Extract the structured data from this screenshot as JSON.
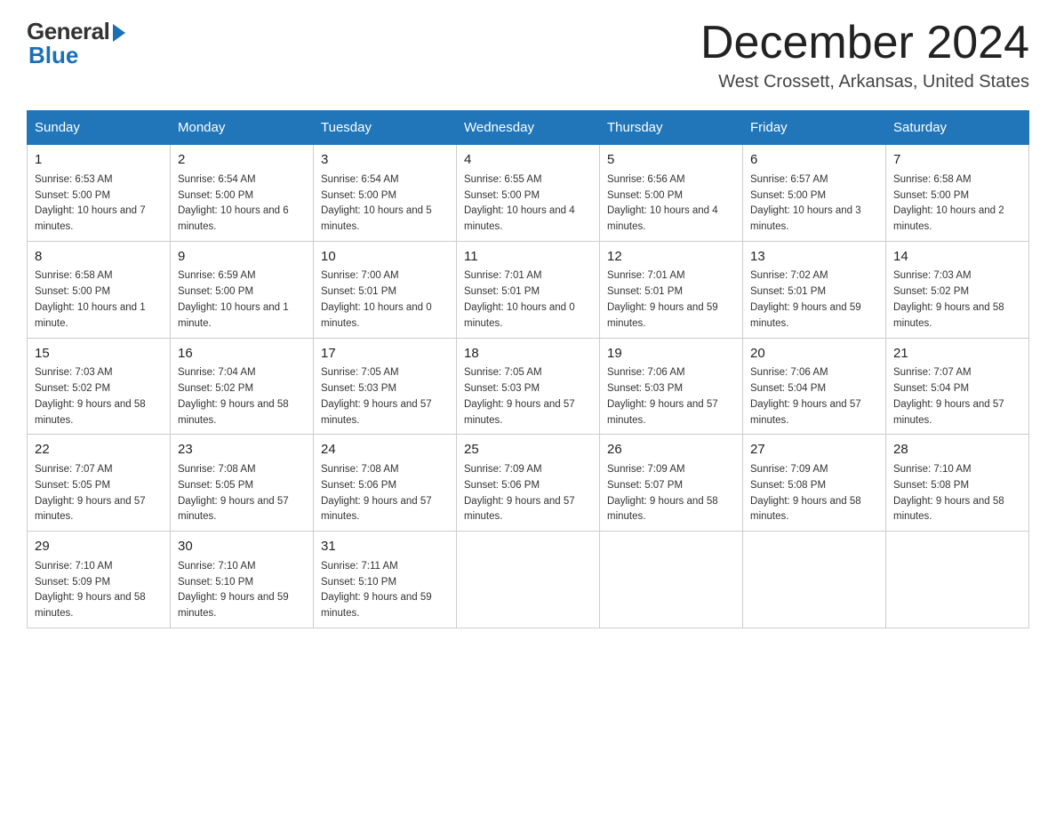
{
  "logo": {
    "general": "General",
    "blue": "Blue"
  },
  "title": {
    "month_year": "December 2024",
    "location": "West Crossett, Arkansas, United States"
  },
  "weekdays": [
    "Sunday",
    "Monday",
    "Tuesday",
    "Wednesday",
    "Thursday",
    "Friday",
    "Saturday"
  ],
  "weeks": [
    [
      {
        "day": "1",
        "sunrise": "6:53 AM",
        "sunset": "5:00 PM",
        "daylight": "10 hours and 7 minutes."
      },
      {
        "day": "2",
        "sunrise": "6:54 AM",
        "sunset": "5:00 PM",
        "daylight": "10 hours and 6 minutes."
      },
      {
        "day": "3",
        "sunrise": "6:54 AM",
        "sunset": "5:00 PM",
        "daylight": "10 hours and 5 minutes."
      },
      {
        "day": "4",
        "sunrise": "6:55 AM",
        "sunset": "5:00 PM",
        "daylight": "10 hours and 4 minutes."
      },
      {
        "day": "5",
        "sunrise": "6:56 AM",
        "sunset": "5:00 PM",
        "daylight": "10 hours and 4 minutes."
      },
      {
        "day": "6",
        "sunrise": "6:57 AM",
        "sunset": "5:00 PM",
        "daylight": "10 hours and 3 minutes."
      },
      {
        "day": "7",
        "sunrise": "6:58 AM",
        "sunset": "5:00 PM",
        "daylight": "10 hours and 2 minutes."
      }
    ],
    [
      {
        "day": "8",
        "sunrise": "6:58 AM",
        "sunset": "5:00 PM",
        "daylight": "10 hours and 1 minute."
      },
      {
        "day": "9",
        "sunrise": "6:59 AM",
        "sunset": "5:00 PM",
        "daylight": "10 hours and 1 minute."
      },
      {
        "day": "10",
        "sunrise": "7:00 AM",
        "sunset": "5:01 PM",
        "daylight": "10 hours and 0 minutes."
      },
      {
        "day": "11",
        "sunrise": "7:01 AM",
        "sunset": "5:01 PM",
        "daylight": "10 hours and 0 minutes."
      },
      {
        "day": "12",
        "sunrise": "7:01 AM",
        "sunset": "5:01 PM",
        "daylight": "9 hours and 59 minutes."
      },
      {
        "day": "13",
        "sunrise": "7:02 AM",
        "sunset": "5:01 PM",
        "daylight": "9 hours and 59 minutes."
      },
      {
        "day": "14",
        "sunrise": "7:03 AM",
        "sunset": "5:02 PM",
        "daylight": "9 hours and 58 minutes."
      }
    ],
    [
      {
        "day": "15",
        "sunrise": "7:03 AM",
        "sunset": "5:02 PM",
        "daylight": "9 hours and 58 minutes."
      },
      {
        "day": "16",
        "sunrise": "7:04 AM",
        "sunset": "5:02 PM",
        "daylight": "9 hours and 58 minutes."
      },
      {
        "day": "17",
        "sunrise": "7:05 AM",
        "sunset": "5:03 PM",
        "daylight": "9 hours and 57 minutes."
      },
      {
        "day": "18",
        "sunrise": "7:05 AM",
        "sunset": "5:03 PM",
        "daylight": "9 hours and 57 minutes."
      },
      {
        "day": "19",
        "sunrise": "7:06 AM",
        "sunset": "5:03 PM",
        "daylight": "9 hours and 57 minutes."
      },
      {
        "day": "20",
        "sunrise": "7:06 AM",
        "sunset": "5:04 PM",
        "daylight": "9 hours and 57 minutes."
      },
      {
        "day": "21",
        "sunrise": "7:07 AM",
        "sunset": "5:04 PM",
        "daylight": "9 hours and 57 minutes."
      }
    ],
    [
      {
        "day": "22",
        "sunrise": "7:07 AM",
        "sunset": "5:05 PM",
        "daylight": "9 hours and 57 minutes."
      },
      {
        "day": "23",
        "sunrise": "7:08 AM",
        "sunset": "5:05 PM",
        "daylight": "9 hours and 57 minutes."
      },
      {
        "day": "24",
        "sunrise": "7:08 AM",
        "sunset": "5:06 PM",
        "daylight": "9 hours and 57 minutes."
      },
      {
        "day": "25",
        "sunrise": "7:09 AM",
        "sunset": "5:06 PM",
        "daylight": "9 hours and 57 minutes."
      },
      {
        "day": "26",
        "sunrise": "7:09 AM",
        "sunset": "5:07 PM",
        "daylight": "9 hours and 58 minutes."
      },
      {
        "day": "27",
        "sunrise": "7:09 AM",
        "sunset": "5:08 PM",
        "daylight": "9 hours and 58 minutes."
      },
      {
        "day": "28",
        "sunrise": "7:10 AM",
        "sunset": "5:08 PM",
        "daylight": "9 hours and 58 minutes."
      }
    ],
    [
      {
        "day": "29",
        "sunrise": "7:10 AM",
        "sunset": "5:09 PM",
        "daylight": "9 hours and 58 minutes."
      },
      {
        "day": "30",
        "sunrise": "7:10 AM",
        "sunset": "5:10 PM",
        "daylight": "9 hours and 59 minutes."
      },
      {
        "day": "31",
        "sunrise": "7:11 AM",
        "sunset": "5:10 PM",
        "daylight": "9 hours and 59 minutes."
      },
      {
        "day": "",
        "sunrise": "",
        "sunset": "",
        "daylight": ""
      },
      {
        "day": "",
        "sunrise": "",
        "sunset": "",
        "daylight": ""
      },
      {
        "day": "",
        "sunrise": "",
        "sunset": "",
        "daylight": ""
      },
      {
        "day": "",
        "sunrise": "",
        "sunset": "",
        "daylight": ""
      }
    ]
  ]
}
